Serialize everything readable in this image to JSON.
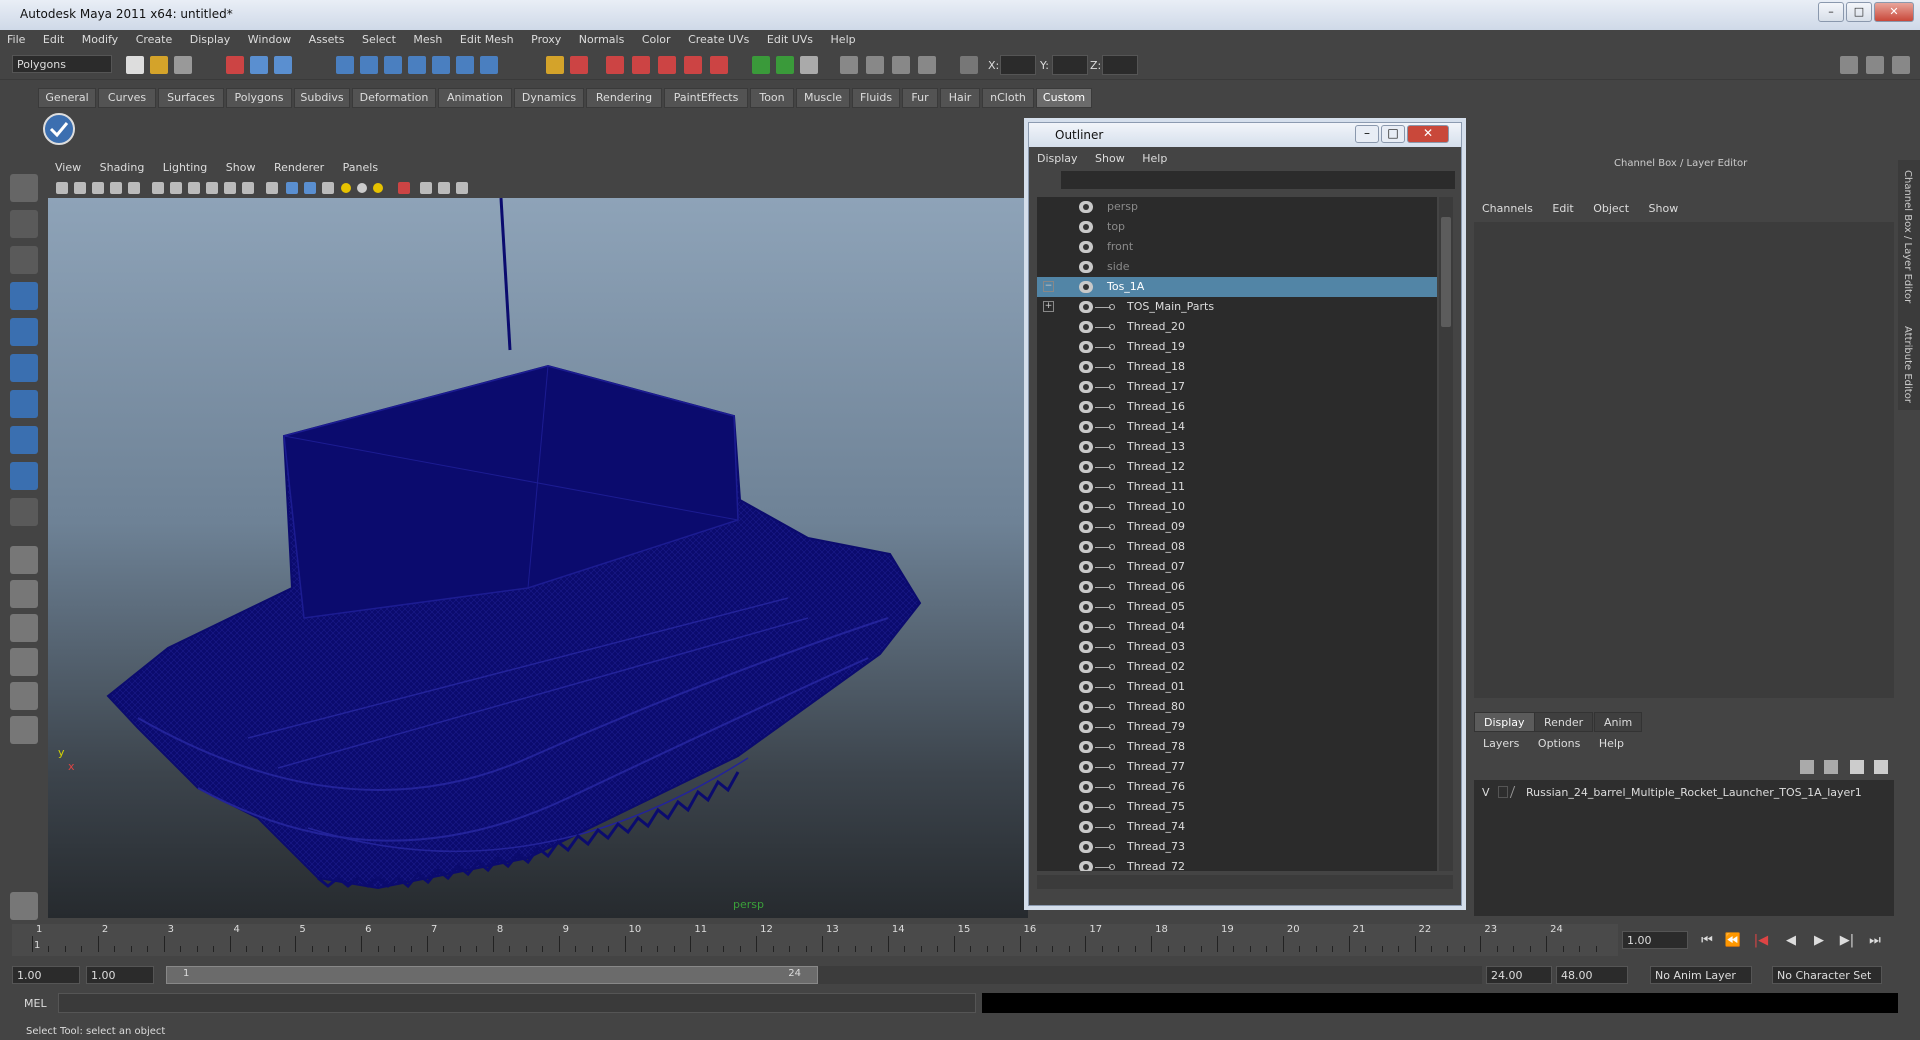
{
  "window": {
    "title": "Autodesk Maya 2011 x64: untitled*",
    "minimize": "–",
    "maximize": "□",
    "close": "✕"
  },
  "menubar": [
    "File",
    "Edit",
    "Modify",
    "Create",
    "Display",
    "Window",
    "Assets",
    "Select",
    "Mesh",
    "Edit Mesh",
    "Proxy",
    "Normals",
    "Color",
    "Create UVs",
    "Edit UVs",
    "Help"
  ],
  "statusline": {
    "menuset": "Polygons",
    "x_label": "X:",
    "y_label": "Y:",
    "z_label": "Z:"
  },
  "shelf": {
    "tabs": [
      "General",
      "Curves",
      "Surfaces",
      "Polygons",
      "Subdivs",
      "Deformation",
      "Animation",
      "Dynamics",
      "Rendering",
      "PaintEffects",
      "Toon",
      "Muscle",
      "Fluids",
      "Fur",
      "Hair",
      "nCloth",
      "Custom"
    ],
    "active_tab": "Custom"
  },
  "viewport": {
    "menu": [
      "View",
      "Shading",
      "Lighting",
      "Show",
      "Renderer",
      "Panels"
    ],
    "camera_label": "persp",
    "axis_y": "y",
    "axis_x": "x",
    "wire_color": "#0b0b6e"
  },
  "outliner": {
    "title": "Outliner",
    "menu": [
      "Display",
      "Show",
      "Help"
    ],
    "cameras": [
      "persp",
      "top",
      "front",
      "side"
    ],
    "selected": "Tos_1A",
    "group": "TOS_Main_Parts",
    "children": [
      "Thread_20",
      "Thread_19",
      "Thread_18",
      "Thread_17",
      "Thread_16",
      "Thread_14",
      "Thread_13",
      "Thread_12",
      "Thread_11",
      "Thread_10",
      "Thread_09",
      "Thread_08",
      "Thread_07",
      "Thread_06",
      "Thread_05",
      "Thread_04",
      "Thread_03",
      "Thread_02",
      "Thread_01",
      "Thread_80",
      "Thread_79",
      "Thread_78",
      "Thread_77",
      "Thread_76",
      "Thread_75",
      "Thread_74",
      "Thread_73",
      "Thread_72"
    ],
    "selection_color": "#5285a6"
  },
  "channelbox": {
    "title": "Channel Box / Layer Editor",
    "menu": [
      "Channels",
      "Edit",
      "Object",
      "Show"
    ],
    "layer_tabs": [
      "Display",
      "Render",
      "Anim"
    ],
    "active_layer_tab": "Display",
    "layer_menu": [
      "Layers",
      "Options",
      "Help"
    ],
    "layer_visible": "V",
    "layer_name": "Russian_24_barrel_Multiple_Rocket_Launcher_TOS_1A_layer1",
    "side_tab_1": "Channel Box / Layer Editor",
    "side_tab_2": "Attribute Editor"
  },
  "timeslider": {
    "ticks": [
      1,
      2,
      3,
      4,
      5,
      6,
      7,
      8,
      9,
      10,
      11,
      12,
      13,
      14,
      15,
      16,
      17,
      18,
      19,
      20,
      21,
      22,
      23,
      24
    ],
    "current_frame_marker": "1",
    "current_frame": "1.00"
  },
  "playback": [
    "⏮",
    "⏪",
    "|◀",
    "◀",
    "▶",
    "▶|",
    "⏭"
  ],
  "rangebar": {
    "start_time": "1.00",
    "playback_start": "1.00",
    "range_start": "1",
    "range_end": "24",
    "playback_end": "24.00",
    "end_time": "48.00",
    "anim_layer": "No Anim Layer",
    "char_set": "No Character Set"
  },
  "cmdline": {
    "label": "MEL"
  },
  "helpline": {
    "text": "Select Tool: select an object"
  }
}
